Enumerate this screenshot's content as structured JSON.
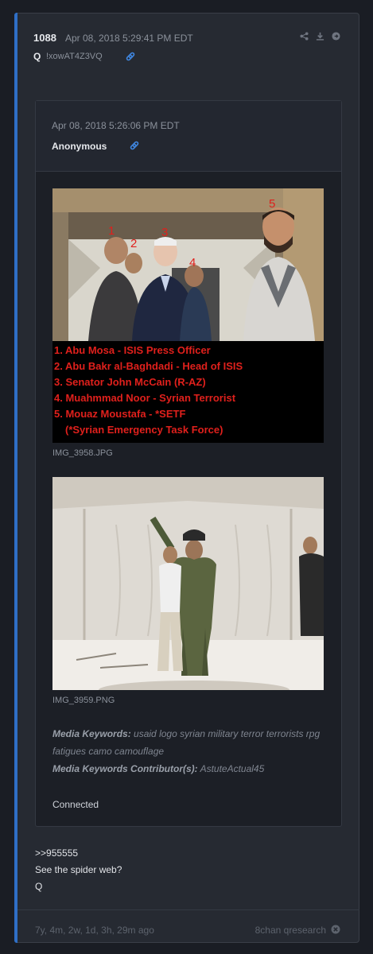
{
  "post": {
    "number": "1088",
    "date": "Apr 08, 2018 5:29:41 PM EDT",
    "author": "Q",
    "tripcode": "!xowAT4Z3VQ"
  },
  "quoted": {
    "date": "Apr 08, 2018 5:26:06 PM EDT",
    "author": "Anonymous",
    "images": [
      {
        "filename": "IMG_3958.JPG",
        "markers": [
          "1",
          "2",
          "3",
          "4",
          "5"
        ],
        "labels": [
          "1. Abu Mosa - ISIS Press Officer",
          "2. Abu Bakr al-Baghdadi - Head of ISIS",
          "3. Senator John McCain (R-AZ)",
          "4. Muahmmad Noor - Syrian Terrorist",
          "5. Mouaz Moustafa - *SETF",
          "(*Syrian Emergency Task Force)"
        ]
      },
      {
        "filename": "IMG_3959.PNG"
      }
    ],
    "media_keywords_label": "Media Keywords:",
    "media_keywords": "usaid logo syrian military terror terrorists rpg fatigues camo camouflage",
    "contributors_label": "Media Keywords Contributor(s):",
    "contributors": "AstuteActual45",
    "body": "Connected"
  },
  "reply": {
    "quote_link": ">>955555",
    "line1": "See the spider web?",
    "line2": "Q"
  },
  "footer": {
    "age": "7y, 4m, 2w, 1d, 3h, 29m ago",
    "board": "8chan qresearch"
  },
  "icons": [
    "share-icon",
    "download-icon",
    "forward-icon",
    "link-icon",
    "close-icon"
  ],
  "colors": {
    "accent": "#2f6fc6",
    "link": "#3f86e0",
    "caption_red": "#e0201c"
  }
}
